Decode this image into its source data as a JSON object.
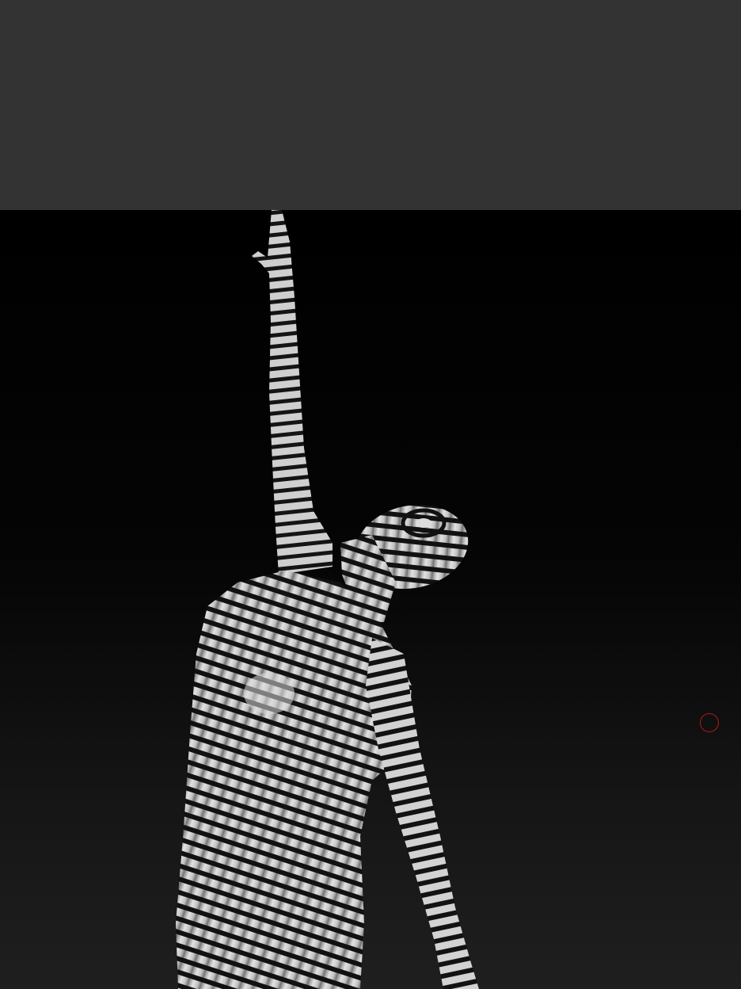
{
  "app": {
    "top_panel": {},
    "viewport": {
      "model": {
        "name": "",
        "icon": "striped-contour-figure"
      },
      "brush_cursor": {
        "icon": "circle-brush-cursor",
        "color": "#b01818"
      }
    }
  },
  "colors": {
    "panel_bg": "#333333",
    "viewport_top": "#000000",
    "viewport_bottom": "#1f1f1f",
    "model_light": "#d6d6d6",
    "model_dark": "#111111",
    "cursor": "#b01818"
  }
}
